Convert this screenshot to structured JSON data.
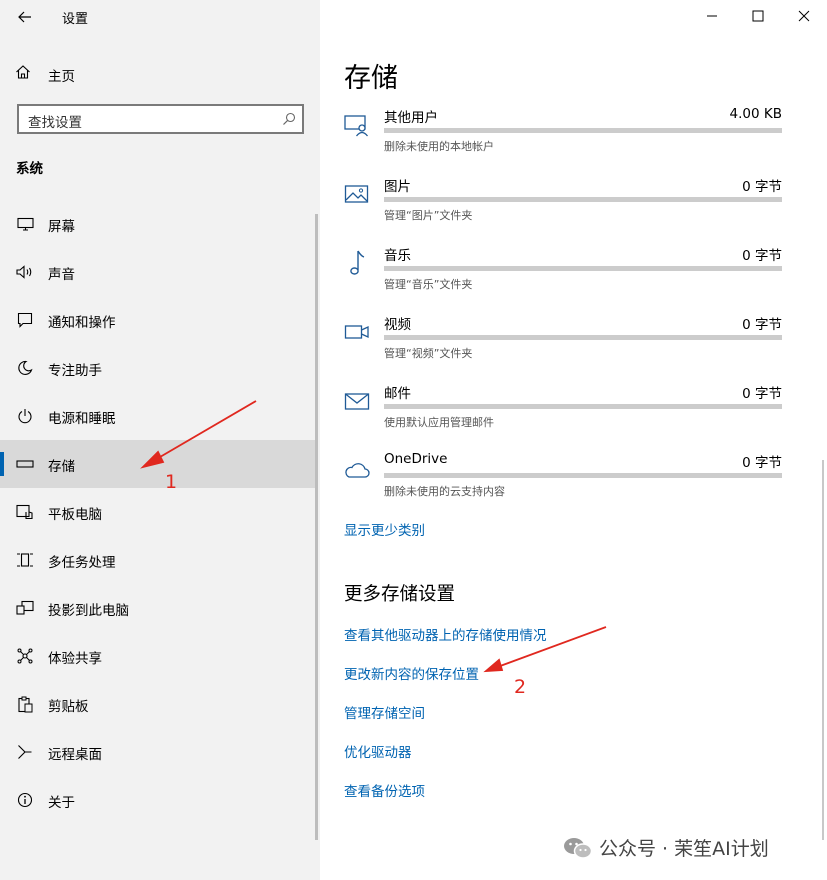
{
  "window": {
    "title": "设置"
  },
  "sidebar": {
    "home_label": "主页",
    "search": {
      "placeholder": "查找设置"
    },
    "section_label": "系统",
    "items": [
      {
        "label": "屏幕",
        "icon": "monitor-icon"
      },
      {
        "label": "声音",
        "icon": "speaker-icon"
      },
      {
        "label": "通知和操作",
        "icon": "notification-icon"
      },
      {
        "label": "专注助手",
        "icon": "moon-icon"
      },
      {
        "label": "电源和睡眠",
        "icon": "power-icon"
      },
      {
        "label": "存储",
        "icon": "storage-icon",
        "selected": true
      },
      {
        "label": "平板电脑",
        "icon": "tablet-icon"
      },
      {
        "label": "多任务处理",
        "icon": "multitask-icon"
      },
      {
        "label": "投影到此电脑",
        "icon": "project-icon"
      },
      {
        "label": "体验共享",
        "icon": "share-icon"
      },
      {
        "label": "剪贴板",
        "icon": "clipboard-icon"
      },
      {
        "label": "远程桌面",
        "icon": "remote-desktop-icon"
      },
      {
        "label": "关于",
        "icon": "info-icon"
      }
    ]
  },
  "main": {
    "title": "存储",
    "categories": [
      {
        "name": "其他用户",
        "size": "4.00 KB",
        "desc": "删除未使用的本地帐户",
        "icon": "other-users-icon",
        "usage": 0
      },
      {
        "name": "图片",
        "size": "0 字节",
        "desc": "管理“图片”文件夹",
        "icon": "pictures-icon",
        "usage": 0
      },
      {
        "name": "音乐",
        "size": "0 字节",
        "desc": "管理“音乐”文件夹",
        "icon": "music-icon",
        "usage": 0
      },
      {
        "name": "视频",
        "size": "0 字节",
        "desc": "管理“视频”文件夹",
        "icon": "video-icon",
        "usage": 0
      },
      {
        "name": "邮件",
        "size": "0 字节",
        "desc": "使用默认应用管理邮件",
        "icon": "mail-icon",
        "usage": 0
      },
      {
        "name": "OneDrive",
        "size": "0 字节",
        "desc": "删除未使用的云支持内容",
        "icon": "onedrive-icon",
        "usage": 0
      }
    ],
    "show_fewer_label": "显示更少类别",
    "more_heading": "更多存储设置",
    "more_links": [
      "查看其他驱动器上的存储使用情况",
      "更改新内容的保存位置",
      "管理存储空间",
      "优化驱动器",
      "查看备份选项"
    ]
  },
  "annotations": {
    "marker_1": "1",
    "marker_2": "2",
    "color": "#e0281f"
  },
  "watermark": {
    "text": "公众号 · 茉笙AI计划",
    "icon": "wechat-icon"
  },
  "colors": {
    "accent": "#0063b1",
    "sidebar_bg": "#f2f2f2",
    "selected_bg": "#d9d9d9"
  }
}
